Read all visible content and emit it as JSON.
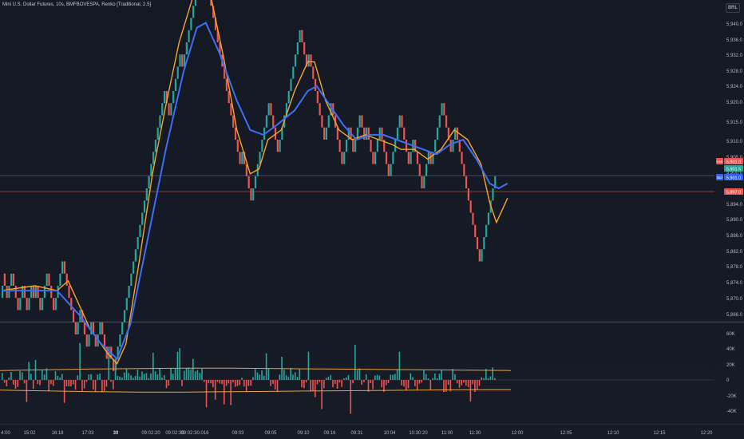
{
  "chart_title": "Mini U.S. Dollar Futures, 10s, BMFBOVESPA, Renko [Traditional, 2.5]",
  "currency_button": "BRL",
  "colors": {
    "background": "#131722",
    "up_brick": "#26a69a",
    "down_brick": "#ef5350",
    "fast_ma": "#f5a623",
    "slow_ma": "#3d6ef5",
    "volume_band": "#e8a33d",
    "ask_label": "#ef5350",
    "last_label": "#26a69a",
    "bid_label": "#2962ff"
  },
  "price_axis": {
    "ticks": [
      "5,940.0",
      "5,936.0",
      "5,932.0",
      "5,928.0",
      "5,924.0",
      "5,920.0",
      "5,915.0",
      "5,910.0",
      "5,905.0",
      "5,900.0",
      "5,894.0",
      "5,890.0",
      "5,886.0",
      "5,882.0",
      "5,878.0",
      "5,874.0",
      "5,870.0",
      "5,866.0"
    ],
    "ask": {
      "tag": "Ask",
      "value": "5,901.0"
    },
    "last": {
      "value": "5,901.5"
    },
    "bid": {
      "tag": "Bid",
      "value": "5,901.0"
    },
    "red_line_label": "5,897.0"
  },
  "volume_axis": {
    "ticks": [
      "60K",
      "40K",
      "20K",
      "0",
      "-20K",
      "-40K"
    ]
  },
  "time_axis": {
    "ticks": [
      "4:00",
      "15:02",
      "16:18",
      "17:03",
      "30",
      "09:02:20",
      "09:02:30",
      "09:02:30.016",
      "09:03",
      "09:05",
      "09:10",
      "09:16",
      "09:31",
      "10:04",
      "10:30:20",
      "11:00",
      "11:30",
      "12:00",
      "12:05",
      "12:10",
      "12:15",
      "12:20"
    ]
  },
  "chart_data": {
    "type": "renko",
    "brick_size": 2.5,
    "bricks": [
      [
        5880,
        1
      ],
      [
        5880,
        0
      ],
      [
        5877.5,
        0
      ],
      [
        5880,
        1
      ],
      [
        5882.5,
        1
      ],
      [
        5880,
        0
      ],
      [
        5877.5,
        0
      ],
      [
        5875,
        0
      ],
      [
        5877.5,
        1
      ],
      [
        5880,
        1
      ],
      [
        5877.5,
        0
      ],
      [
        5875,
        0
      ],
      [
        5877.5,
        1
      ],
      [
        5880,
        1
      ],
      [
        5877.5,
        0
      ],
      [
        5880,
        1
      ],
      [
        5877.5,
        0
      ],
      [
        5875,
        0
      ],
      [
        5877.5,
        1
      ],
      [
        5880,
        1
      ],
      [
        5882.5,
        1
      ],
      [
        5880,
        0
      ],
      [
        5877.5,
        0
      ],
      [
        5875,
        0
      ],
      [
        5877.5,
        1
      ],
      [
        5880,
        1
      ],
      [
        5882.5,
        1
      ],
      [
        5885,
        1
      ],
      [
        5882.5,
        0
      ],
      [
        5880,
        0
      ],
      [
        5877.5,
        0
      ],
      [
        5875,
        0
      ],
      [
        5872.5,
        0
      ],
      [
        5870,
        0
      ],
      [
        5872.5,
        1
      ],
      [
        5875,
        1
      ],
      [
        5872.5,
        0
      ],
      [
        5870,
        0
      ],
      [
        5867.5,
        0
      ],
      [
        5870,
        1
      ],
      [
        5872.5,
        1
      ],
      [
        5870,
        0
      ],
      [
        5867.5,
        0
      ],
      [
        5870,
        1
      ],
      [
        5872.5,
        1
      ],
      [
        5870,
        0
      ],
      [
        5867.5,
        0
      ],
      [
        5865,
        0
      ],
      [
        5867.5,
        1
      ],
      [
        5865,
        0
      ],
      [
        5862.5,
        0
      ],
      [
        5865,
        1
      ],
      [
        5867.5,
        1
      ],
      [
        5870,
        1
      ],
      [
        5872.5,
        1
      ],
      [
        5875,
        1
      ],
      [
        5877.5,
        1
      ],
      [
        5880,
        1
      ],
      [
        5882.5,
        1
      ],
      [
        5885,
        1
      ],
      [
        5887.5,
        1
      ],
      [
        5890,
        1
      ],
      [
        5892.5,
        1
      ],
      [
        5895,
        1
      ],
      [
        5897.5,
        1
      ],
      [
        5900,
        1
      ],
      [
        5902.5,
        1
      ],
      [
        5905,
        1
      ],
      [
        5907.5,
        1
      ],
      [
        5910,
        1
      ],
      [
        5912.5,
        1
      ],
      [
        5915,
        1
      ],
      [
        5917.5,
        1
      ],
      [
        5920,
        1
      ],
      [
        5917.5,
        0
      ],
      [
        5915,
        0
      ],
      [
        5917.5,
        1
      ],
      [
        5920,
        1
      ],
      [
        5922.5,
        1
      ],
      [
        5925,
        1
      ],
      [
        5927.5,
        1
      ],
      [
        5925,
        0
      ],
      [
        5927.5,
        1
      ],
      [
        5930,
        1
      ],
      [
        5932.5,
        1
      ],
      [
        5935,
        1
      ],
      [
        5937.5,
        1
      ],
      [
        5940,
        1
      ],
      [
        5942.5,
        1
      ],
      [
        5945,
        1
      ],
      [
        5947.5,
        1
      ],
      [
        5945,
        0
      ],
      [
        5942.5,
        0
      ],
      [
        5940,
        0
      ],
      [
        5937.5,
        0
      ],
      [
        5935,
        0
      ],
      [
        5932.5,
        0
      ],
      [
        5930,
        0
      ],
      [
        5927.5,
        0
      ],
      [
        5925,
        0
      ],
      [
        5922.5,
        0
      ],
      [
        5920,
        0
      ],
      [
        5917.5,
        0
      ],
      [
        5915,
        0
      ],
      [
        5912.5,
        0
      ],
      [
        5910,
        0
      ],
      [
        5907.5,
        0
      ],
      [
        5905,
        0
      ],
      [
        5907.5,
        1
      ],
      [
        5905,
        0
      ],
      [
        5902.5,
        0
      ],
      [
        5900,
        0
      ],
      [
        5897.5,
        0
      ],
      [
        5900,
        1
      ],
      [
        5902.5,
        1
      ],
      [
        5905,
        1
      ],
      [
        5907.5,
        1
      ],
      [
        5910,
        1
      ],
      [
        5912.5,
        1
      ],
      [
        5915,
        1
      ],
      [
        5917.5,
        1
      ],
      [
        5915,
        0
      ],
      [
        5912.5,
        0
      ],
      [
        5910,
        0
      ],
      [
        5907.5,
        0
      ],
      [
        5910,
        1
      ],
      [
        5912.5,
        1
      ],
      [
        5915,
        1
      ],
      [
        5917.5,
        1
      ],
      [
        5920,
        1
      ],
      [
        5922.5,
        1
      ],
      [
        5925,
        1
      ],
      [
        5927.5,
        1
      ],
      [
        5930,
        1
      ],
      [
        5932.5,
        1
      ],
      [
        5930,
        0
      ],
      [
        5927.5,
        0
      ],
      [
        5925,
        0
      ],
      [
        5927.5,
        1
      ],
      [
        5925,
        0
      ],
      [
        5922.5,
        0
      ],
      [
        5920,
        0
      ],
      [
        5917.5,
        0
      ],
      [
        5915,
        0
      ],
      [
        5912.5,
        0
      ],
      [
        5910,
        0
      ],
      [
        5912.5,
        1
      ],
      [
        5915,
        1
      ],
      [
        5917.5,
        1
      ],
      [
        5915,
        0
      ],
      [
        5912.5,
        0
      ],
      [
        5910,
        0
      ],
      [
        5907.5,
        0
      ],
      [
        5905,
        0
      ],
      [
        5907.5,
        1
      ],
      [
        5910,
        1
      ],
      [
        5912.5,
        1
      ],
      [
        5910,
        0
      ],
      [
        5907.5,
        0
      ],
      [
        5910,
        1
      ],
      [
        5912.5,
        1
      ],
      [
        5915,
        1
      ],
      [
        5912.5,
        0
      ],
      [
        5910,
        0
      ],
      [
        5912.5,
        1
      ],
      [
        5910,
        0
      ],
      [
        5907.5,
        0
      ],
      [
        5905,
        0
      ],
      [
        5907.5,
        1
      ],
      [
        5910,
        1
      ],
      [
        5912.5,
        1
      ],
      [
        5910,
        0
      ],
      [
        5907.5,
        0
      ],
      [
        5905,
        0
      ],
      [
        5902.5,
        0
      ],
      [
        5905,
        1
      ],
      [
        5907.5,
        1
      ],
      [
        5910,
        1
      ],
      [
        5912.5,
        1
      ],
      [
        5915,
        1
      ],
      [
        5912.5,
        0
      ],
      [
        5910,
        0
      ],
      [
        5907.5,
        0
      ],
      [
        5905,
        0
      ],
      [
        5907.5,
        1
      ],
      [
        5910,
        1
      ],
      [
        5907.5,
        0
      ],
      [
        5905,
        0
      ],
      [
        5902.5,
        0
      ],
      [
        5900,
        0
      ],
      [
        5902.5,
        1
      ],
      [
        5905,
        1
      ],
      [
        5907.5,
        1
      ],
      [
        5905,
        0
      ],
      [
        5907.5,
        1
      ],
      [
        5910,
        1
      ],
      [
        5912.5,
        1
      ],
      [
        5915,
        1
      ],
      [
        5917.5,
        1
      ],
      [
        5915,
        0
      ],
      [
        5912.5,
        0
      ],
      [
        5910,
        0
      ],
      [
        5907.5,
        0
      ],
      [
        5910,
        1
      ],
      [
        5912.5,
        1
      ],
      [
        5910,
        0
      ],
      [
        5907.5,
        0
      ],
      [
        5905,
        0
      ],
      [
        5902.5,
        0
      ],
      [
        5900,
        0
      ],
      [
        5897.5,
        0
      ],
      [
        5895,
        0
      ],
      [
        5892.5,
        0
      ],
      [
        5890,
        0
      ],
      [
        5887.5,
        0
      ],
      [
        5885,
        0
      ],
      [
        5887.5,
        1
      ],
      [
        5890,
        1
      ],
      [
        5892.5,
        1
      ],
      [
        5895,
        1
      ],
      [
        5897.5,
        1
      ],
      [
        5900,
        1
      ],
      [
        5902.5,
        1
      ]
    ],
    "fast_ma": [
      [
        0,
        5879
      ],
      [
        15,
        5880
      ],
      [
        25,
        5879
      ],
      [
        30,
        5881
      ],
      [
        40,
        5871
      ],
      [
        48,
        5866
      ],
      [
        52,
        5864
      ],
      [
        56,
        5868
      ],
      [
        62,
        5885
      ],
      [
        68,
        5903
      ],
      [
        74,
        5917
      ],
      [
        80,
        5930
      ],
      [
        86,
        5939
      ],
      [
        90,
        5942
      ],
      [
        94,
        5940
      ],
      [
        100,
        5927
      ],
      [
        106,
        5912
      ],
      [
        112,
        5903
      ],
      [
        116,
        5904
      ],
      [
        120,
        5910
      ],
      [
        126,
        5912
      ],
      [
        132,
        5920
      ],
      [
        138,
        5926
      ],
      [
        141,
        5926
      ],
      [
        146,
        5918
      ],
      [
        152,
        5912
      ],
      [
        158,
        5910
      ],
      [
        164,
        5911
      ],
      [
        170,
        5910
      ],
      [
        176,
        5909
      ],
      [
        180,
        5908
      ],
      [
        186,
        5908
      ],
      [
        192,
        5906
      ],
      [
        198,
        5908
      ],
      [
        204,
        5912
      ],
      [
        210,
        5910
      ],
      [
        216,
        5905
      ],
      [
        220,
        5897
      ],
      [
        223,
        5893
      ],
      [
        226,
        5896
      ],
      [
        228,
        5898
      ]
    ],
    "slow_ma": [
      [
        0,
        5879
      ],
      [
        15,
        5879
      ],
      [
        25,
        5879
      ],
      [
        35,
        5874
      ],
      [
        45,
        5868
      ],
      [
        52,
        5865
      ],
      [
        58,
        5872
      ],
      [
        66,
        5890
      ],
      [
        74,
        5908
      ],
      [
        82,
        5924
      ],
      [
        88,
        5933
      ],
      [
        92,
        5934
      ],
      [
        98,
        5928
      ],
      [
        106,
        5918
      ],
      [
        112,
        5912
      ],
      [
        118,
        5911
      ],
      [
        124,
        5913
      ],
      [
        132,
        5916
      ],
      [
        138,
        5920
      ],
      [
        142,
        5921
      ],
      [
        148,
        5917
      ],
      [
        154,
        5913
      ],
      [
        160,
        5910
      ],
      [
        166,
        5911
      ],
      [
        172,
        5911
      ],
      [
        178,
        5910
      ],
      [
        184,
        5909
      ],
      [
        190,
        5908
      ],
      [
        196,
        5907
      ],
      [
        202,
        5909
      ],
      [
        208,
        5910
      ],
      [
        214,
        5906
      ],
      [
        220,
        5901
      ],
      [
        224,
        5900
      ],
      [
        228,
        5901
      ]
    ],
    "volume_upper_band": [
      12,
      13,
      14,
      14.5,
      15,
      15,
      14.5,
      14,
      13.5,
      13,
      12.5,
      12
    ],
    "volume_lower_band": [
      -13,
      -14,
      -15,
      -15.5,
      -15.5,
      -15,
      -14.5,
      -14,
      -13.5,
      -13,
      -12.5,
      -12.5
    ]
  }
}
